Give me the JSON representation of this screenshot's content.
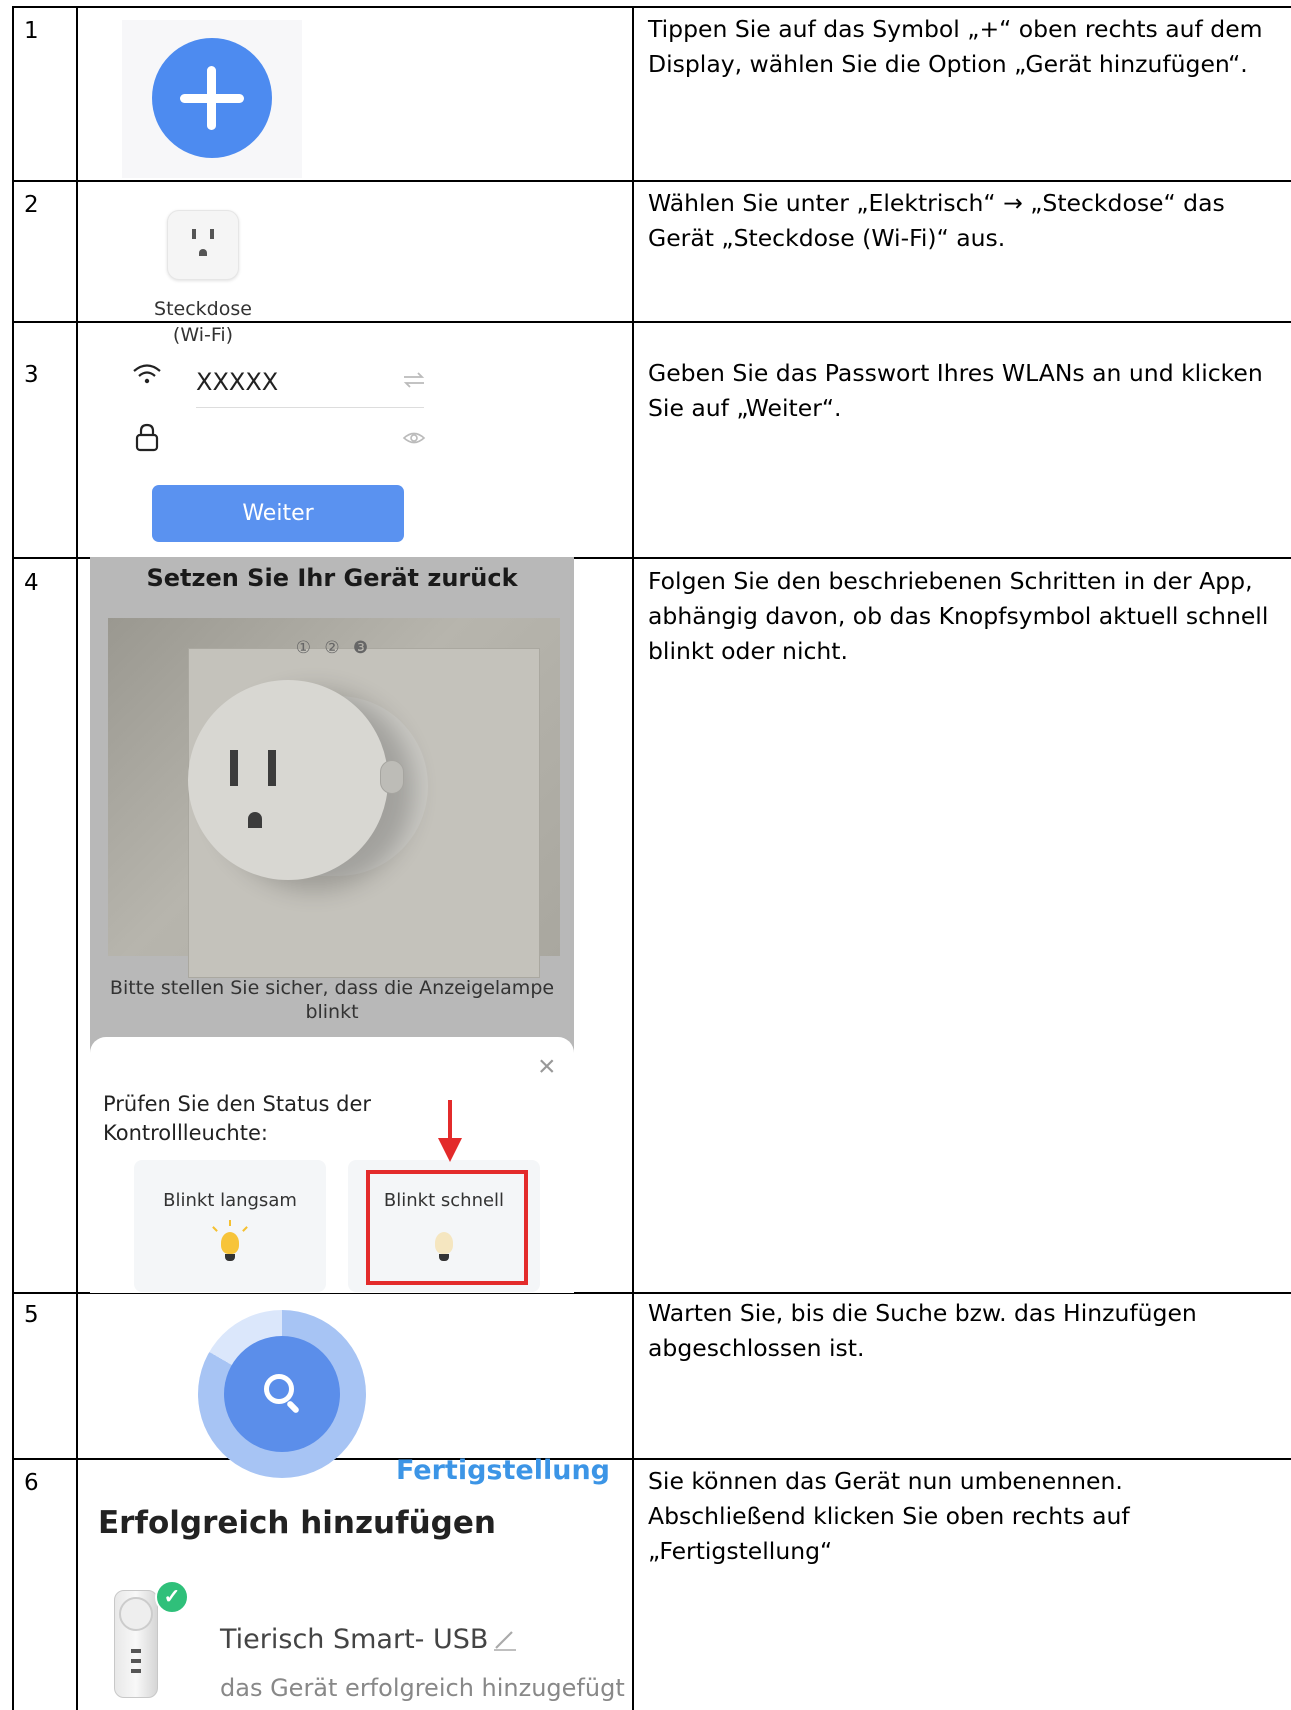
{
  "rows": [
    {
      "number": "1",
      "description": "Tippen Sie auf das Symbol „+“ oben rechts auf dem Display, wählen Sie die Option „Gerät hinzufügen“."
    },
    {
      "number": "2",
      "description": "Wählen Sie unter „Elektrisch“ → „Steckdose“ das Gerät „Steckdose (Wi-Fi)“ aus.",
      "device_label_line1": "Steckdose",
      "device_label_line2": "(Wi-Fi)"
    },
    {
      "number": "3",
      "description": "Geben Sie das Passwort Ihres WLANs an und klicken Sie auf „Weiter“.",
      "wifi_name": "XXXXX",
      "button_label": "Weiter"
    },
    {
      "number": "4",
      "description": "Folgen Sie den beschriebenen Schritten in der App, abhängig davon, ob das Knopfsymbol aktuell schnell blinkt oder nicht.",
      "screen_title": "Setzen Sie Ihr Gerät zurück",
      "steps": "① ② ❸",
      "note": "Bitte stellen Sie sicher, dass die Anzeigelampe blinkt",
      "question": "Prüfen Sie den Status der Kontrollleuchte:",
      "option_slow": "Blinkt langsam",
      "option_fast": "Blinkt schnell"
    },
    {
      "number": "5",
      "description": "Warten Sie, bis die Suche bzw. das Hinzufügen abgeschlossen ist."
    },
    {
      "number": "6",
      "description": "Sie können das Gerät nun umbenennen. Abschließend klicken Sie oben rechts auf „Fertigstellung“",
      "done_link": "Fertigstellung",
      "success_title": "Erfolgreich hinzufügen",
      "device_name": "Tierisch Smart- USB",
      "device_status": "das Gerät erfolgreich hinzugefügt"
    }
  ],
  "colors": {
    "accent_blue": "#4d8bf0",
    "button_blue": "#5a92f0",
    "link_blue": "#3c95e6",
    "highlight_red": "#e32b2b",
    "success_green": "#2fc07a"
  },
  "icons": [
    "plus-icon",
    "wall-socket-icon",
    "wifi-icon",
    "switch-network-icon",
    "lock-icon",
    "eye-icon",
    "close-icon",
    "bulb-icon",
    "search-icon",
    "check-icon",
    "edit-pencil-icon"
  ]
}
